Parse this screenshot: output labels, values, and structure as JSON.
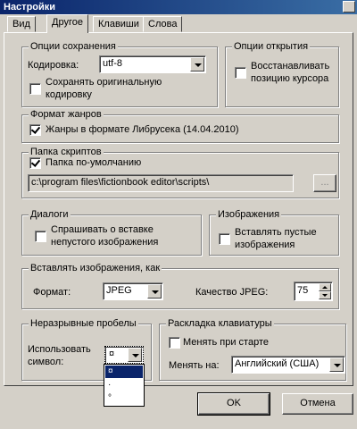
{
  "window": {
    "title": "Настройки"
  },
  "tabs": [
    {
      "label": "Вид"
    },
    {
      "label": "Другое"
    },
    {
      "label": "Клавиши"
    },
    {
      "label": "Слова"
    }
  ],
  "save_options": {
    "legend": "Опции сохранения",
    "encoding_label": "Кодировка:",
    "encoding_value": "utf-8",
    "keep_encoding_label": "Сохранять оригинальную кодировку",
    "keep_encoding_line1": "Сохранять оригинальную",
    "keep_encoding_line2": "кодировку",
    "keep_encoding_checked": false
  },
  "open_options": {
    "legend": "Опции открытия",
    "restore_line1": "Восстанавливать",
    "restore_line2": "позицию курсора",
    "restore_checked": false
  },
  "genre_format": {
    "legend": "Формат жанров",
    "librusec_label": "Жанры в формате Либрусека (14.04.2010)",
    "librusec_checked": true
  },
  "scripts_folder": {
    "legend": "Папка скриптов",
    "default_label": "Папка по-умолчанию",
    "default_checked": true,
    "path_value": "c:\\program files\\fictionbook editor\\scripts\\",
    "browse_label": "..."
  },
  "dialogs": {
    "legend": "Диалоги",
    "ask_line1": "Спрашивать о вставке",
    "ask_line2": "непустого изображения",
    "ask_checked": false
  },
  "images": {
    "legend": "Изображения",
    "insert_empty_line1": "Вставлять пустые",
    "insert_empty_line2": "изображения",
    "insert_empty_checked": false
  },
  "insert_images_as": {
    "legend": "Вставлять изображения, как",
    "format_label": "Формат:",
    "format_value": "JPEG",
    "quality_label": "Качество JPEG:",
    "quality_value": "75"
  },
  "nbsp": {
    "legend": "Неразрывные пробелы",
    "use_line1": "Использовать",
    "use_line2": "символ:",
    "symbol_value": "¤",
    "options": [
      "¤",
      "·",
      "°"
    ]
  },
  "keyboard_layout": {
    "legend": "Раскладка клавиатуры",
    "change_on_start_label": "Менять при старте",
    "change_on_start_checked": false,
    "change_to_label": "Менять на:",
    "change_to_value": "Английский (США)"
  },
  "buttons": {
    "ok": "OK",
    "cancel": "Отмена"
  }
}
